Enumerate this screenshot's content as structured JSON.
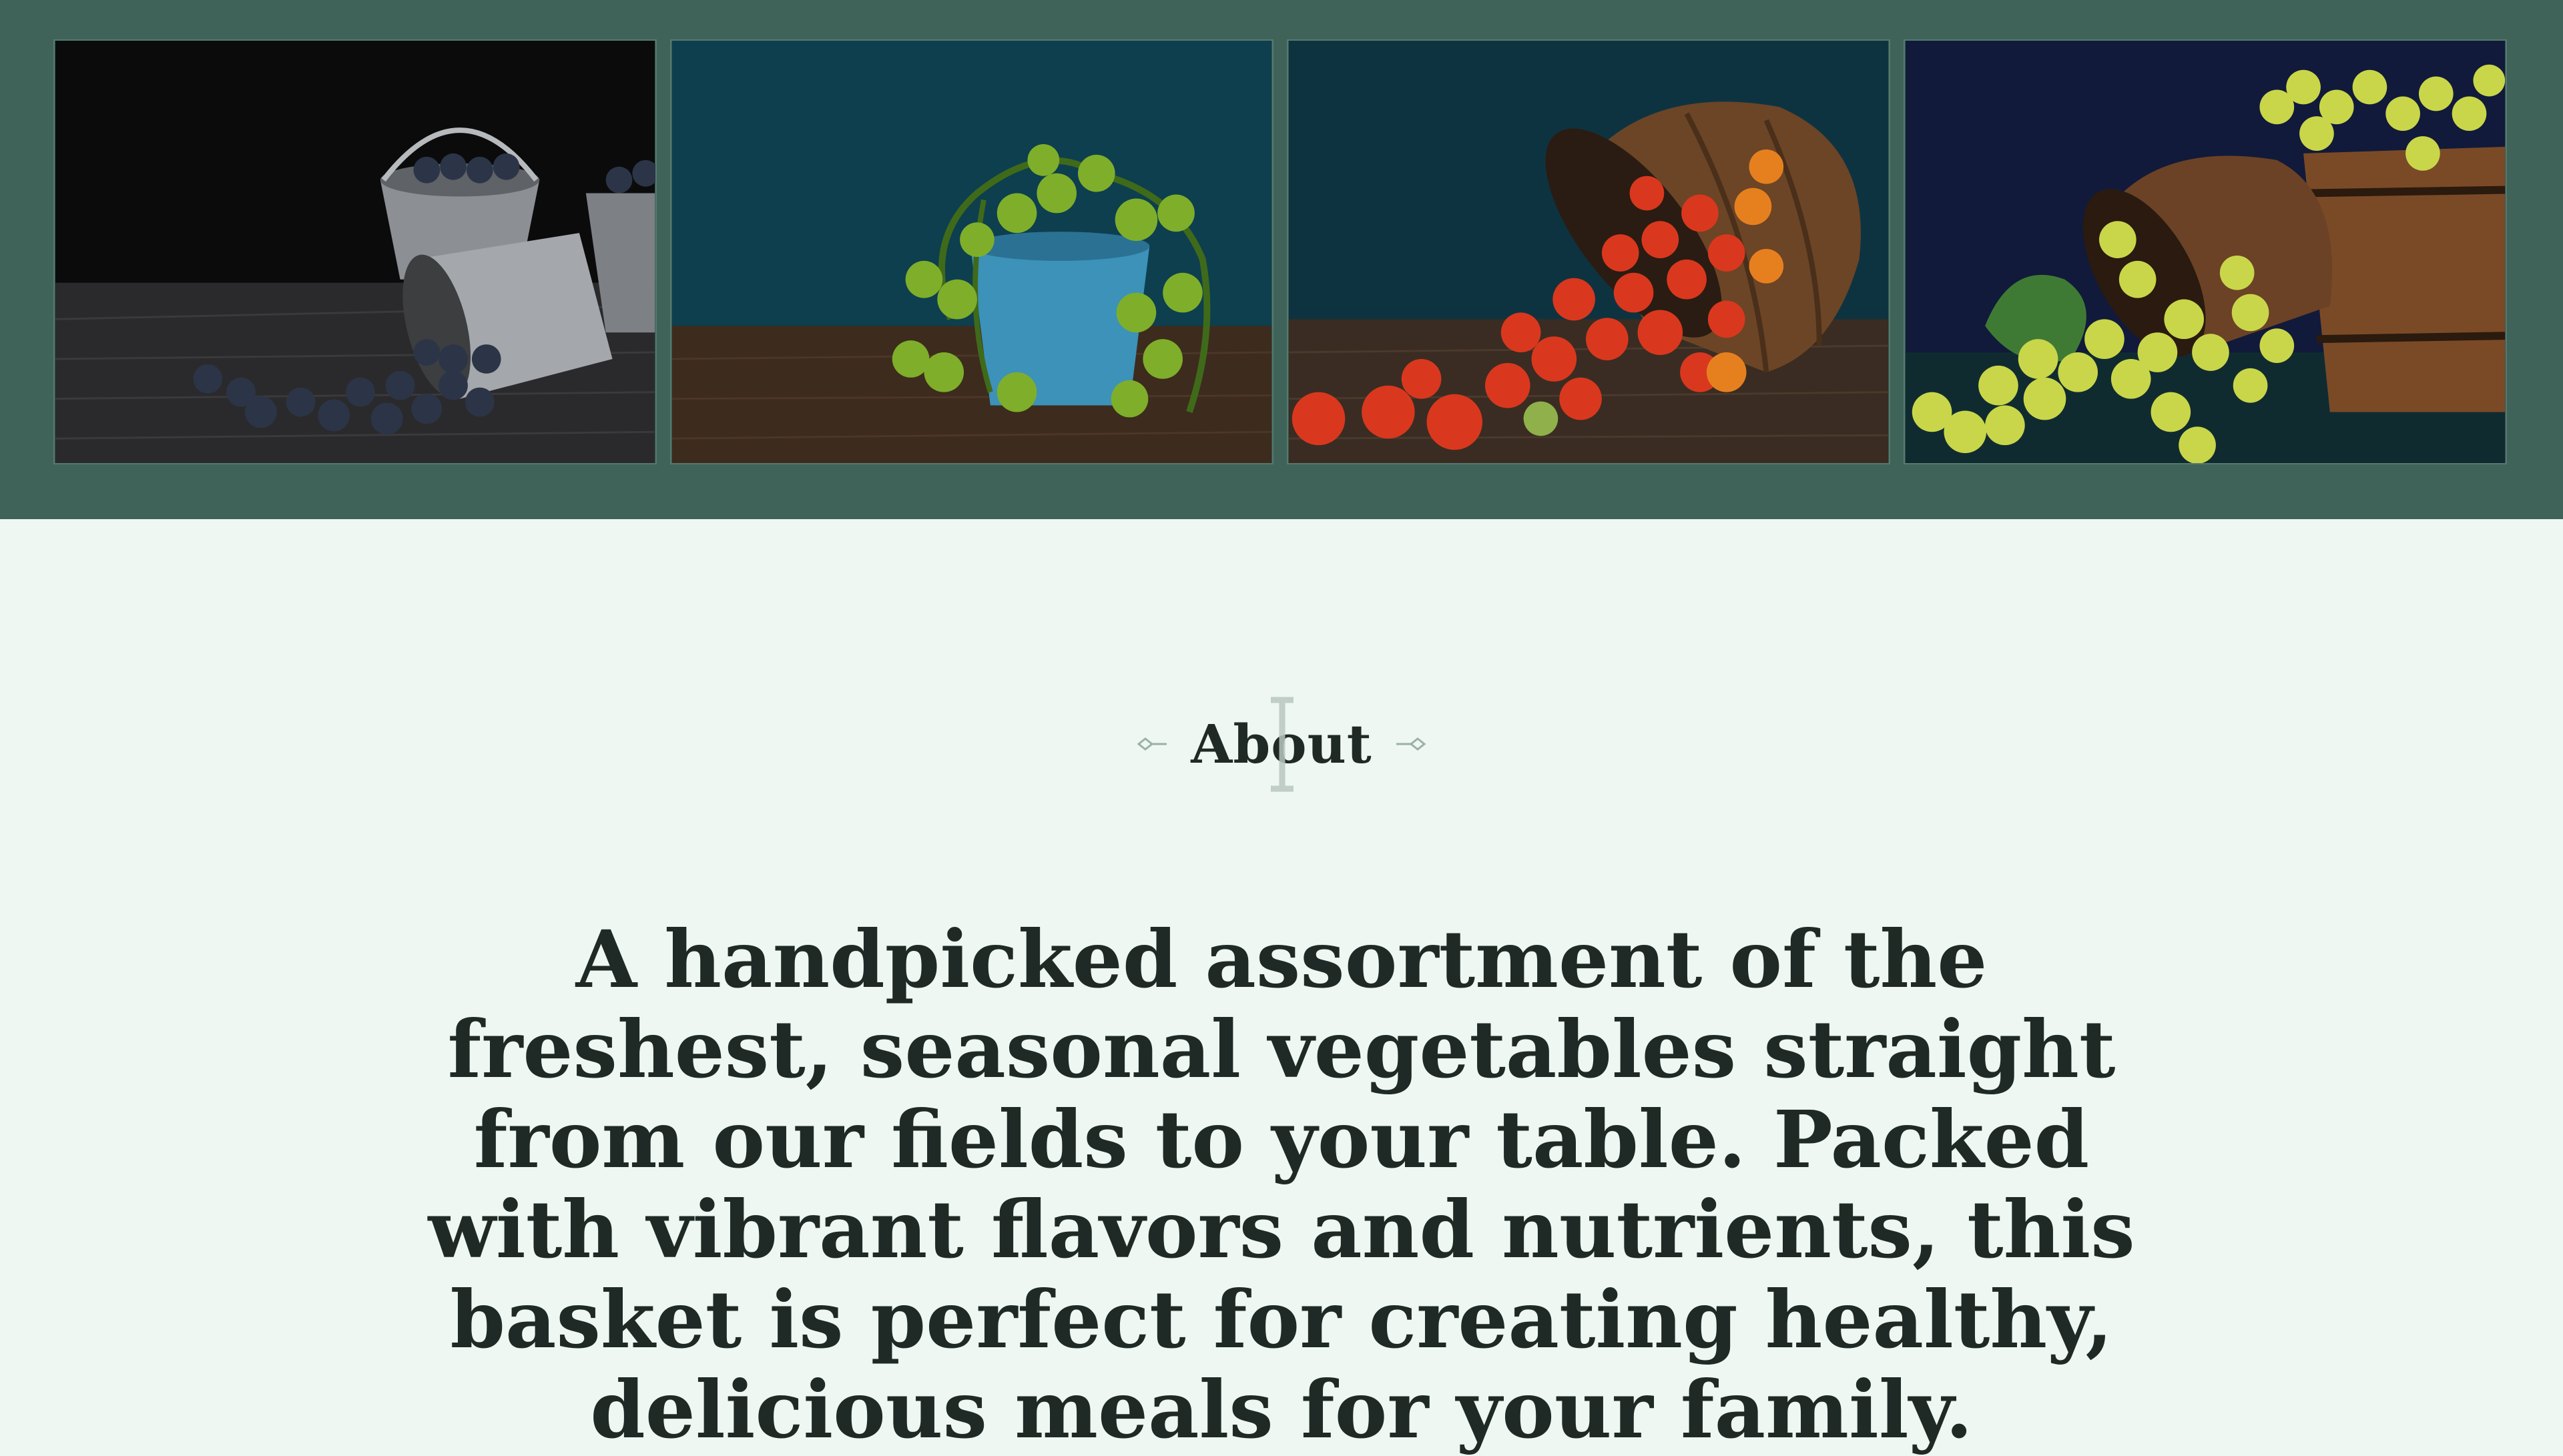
{
  "gallery": {
    "photos": [
      {
        "subject": "blueberries spilling from metal pails",
        "icon": "blueberries-photo"
      },
      {
        "subject": "green cherry tomatoes in a blue bucket",
        "icon": "green-tomatoes-photo"
      },
      {
        "subject": "red cherry tomatoes spilling from a wooden barrel",
        "icon": "red-tomatoes-photo"
      },
      {
        "subject": "green grapes spilling from wooden barrels",
        "icon": "grapes-photo"
      }
    ],
    "background_color": "#3f6358"
  },
  "about": {
    "title": "About",
    "description": "A handpicked assortment of the freshest, seasonal vegetables straight from our fields to your table. Packed with vibrant flavors and nutrients, this basket is perfect for creating healthy, delicious meals for your family."
  },
  "colors": {
    "page_background": "#eef7f2",
    "text": "#1f2a26",
    "ornament": "#9bb0a7"
  }
}
